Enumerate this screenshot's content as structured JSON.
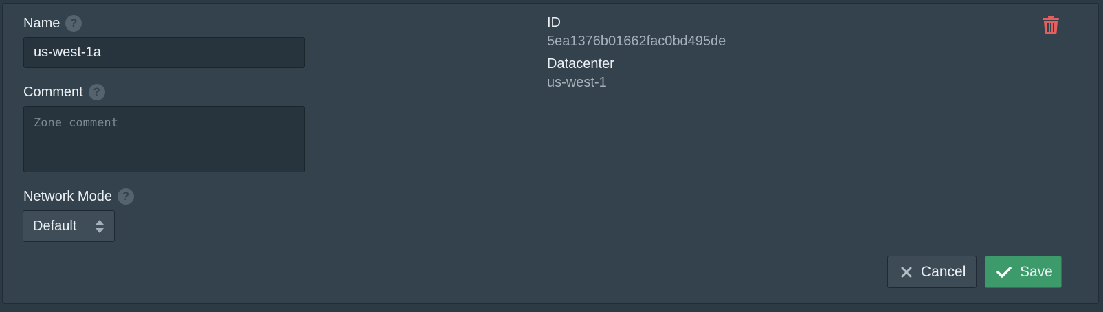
{
  "form": {
    "name": {
      "label": "Name",
      "value": "us-west-1a"
    },
    "comment": {
      "label": "Comment",
      "placeholder": "Zone comment",
      "value": ""
    },
    "network_mode": {
      "label": "Network Mode",
      "selected": "Default"
    }
  },
  "info": {
    "id_label": "ID",
    "id_value": "5ea1376b01662fac0bd495de",
    "datacenter_label": "Datacenter",
    "datacenter_value": "us-west-1"
  },
  "actions": {
    "cancel_label": "Cancel",
    "save_label": "Save",
    "delete_icon": "trash-icon"
  },
  "colors": {
    "background": "#34424e",
    "save": "#3d9a6a",
    "delete": "#e4605e"
  }
}
